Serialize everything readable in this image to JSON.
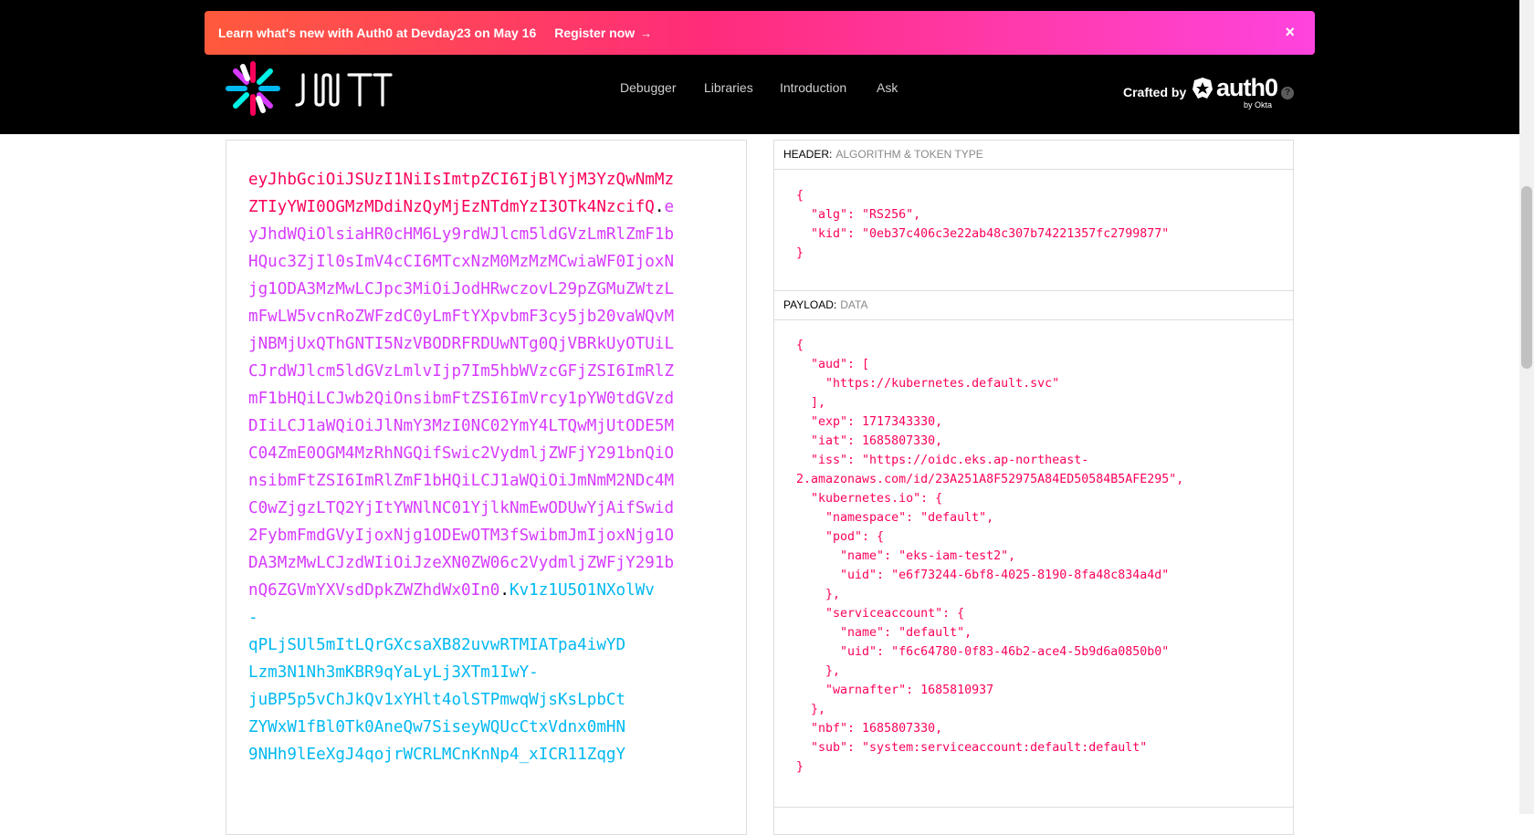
{
  "banner": {
    "message": "Learn what's new with Auth0 at Devday23 on May 16",
    "cta": "Register now",
    "cta_arrow": "→",
    "close": "×"
  },
  "nav": {
    "debugger": "Debugger",
    "libraries": "Libraries",
    "introduction": "Introduction",
    "ask": "Ask"
  },
  "brand": {
    "crafted_by": "Crafted by",
    "auth0": "auth0",
    "by_okta": "by Okta",
    "help": "?"
  },
  "colors": {
    "header": "#fb015b",
    "payload": "#d63aff",
    "signature": "#00b9f1"
  },
  "encoded": {
    "header": "eyJhbGciOiJSUzI1NiIsImtpZCI6IjBlYjM3YzQwNmMzZTIyYWI0OGMzMDdiNzQyMjEzNTdmYzI3OTk4NzcifQ",
    "dot1": ".",
    "payload": "eyJhdWQiOlsiaHR0cHM6Ly9rdWJlcm5ldGVzLmRlZmF1bHQuc3ZjIl0sImV4cCI6MTcxNzM0MzMzMCwiaWF0IjoxNjg1ODA3MzMwLCJpc3MiOiJodHRwczovL29pZGMuZWtzLmFwLW5vcnRoZWFzdC0yLmFtYXpvbmF3cy5jb20vaWQvMjNBMjUxQThGNTI5NzVBODRFRDUwNTg0QjVBRkUyOTUiLCJrdWJlcm5ldGVzLmlvIjp7Im5hbWVzcGFjZSI6ImRlZmF1bHQiLCJwb2QiOnsibmFtZSI6ImVrcy1pYW0tdGVzdDIiLCJ1aWQiOiJlNmY3MzI0NC02YmY4LTQwMjUtODE5MC04ZmE0OGM4MzRhNGQifSwic2VydmljZWFjY291bnQiOnsibmFtZSI6ImRlZmF1bHQiLCJ1aWQiOiJmNmM2NDc4MC0wZjgzLTQ2YjItYWNlNC01YjlkNmEwODUwYjAifSwid2FybmFmdGVyIjoxNjg1ODEwOTM3fSwibmJmIjoxNjg1ODA3MzMwLCJzdWIiOiJzeXN0ZW06c2VydmljZWFjY291bnQ6ZGVmYXVsdDpkZWZhdWx0In0",
    "dot2": ".",
    "signature_lines": [
      "Kv1z1U5O1NXolWv",
      "-",
      "qPLjSUl5mItLQrGXcsaXB82uvwRTMIATpa4iwYD",
      "Lzm3N1Nh3mKBR9qYaLyLj3XTm1IwY-",
      "juBP5p5vChJkQv1xYHlt4olSTPmwqWjsKsLpbCt",
      "ZYWxW1fBl0Tk0AneQw7SiseyWQUcCtxVdnx0mHN",
      "9NHh9lEeXgJ4qojrWCRLMCnKnNp4_xICR11ZqgY"
    ]
  },
  "decoded": {
    "header_section": {
      "key": "HEADER:",
      "label": "ALGORITHM & TOKEN TYPE"
    },
    "header_json": "{\n  \"alg\": \"RS256\",\n  \"kid\": \"0eb37c406c3e22ab48c307b74221357fc2799877\"\n}",
    "payload_section": {
      "key": "PAYLOAD:",
      "label": "DATA"
    },
    "payload_json": "{\n  \"aud\": [\n    \"https://kubernetes.default.svc\"\n  ],\n  \"exp\": 1717343330,\n  \"iat\": 1685807330,\n  \"iss\": \"https://oidc.eks.ap-northeast-\n2.amazonaws.com/id/23A251A8F52975A84ED50584B5AFE295\",\n  \"kubernetes.io\": {\n    \"namespace\": \"default\",\n    \"pod\": {\n      \"name\": \"eks-iam-test2\",\n      \"uid\": \"e6f73244-6bf8-4025-8190-8fa48c834a4d\"\n    },\n    \"serviceaccount\": {\n      \"name\": \"default\",\n      \"uid\": \"f6c64780-0f83-46b2-ace4-5b9d6a0850b0\"\n    },\n    \"warnafter\": 1685810937\n  },\n  \"nbf\": 1685807330,\n  \"sub\": \"system:serviceaccount:default:default\"\n}"
  }
}
